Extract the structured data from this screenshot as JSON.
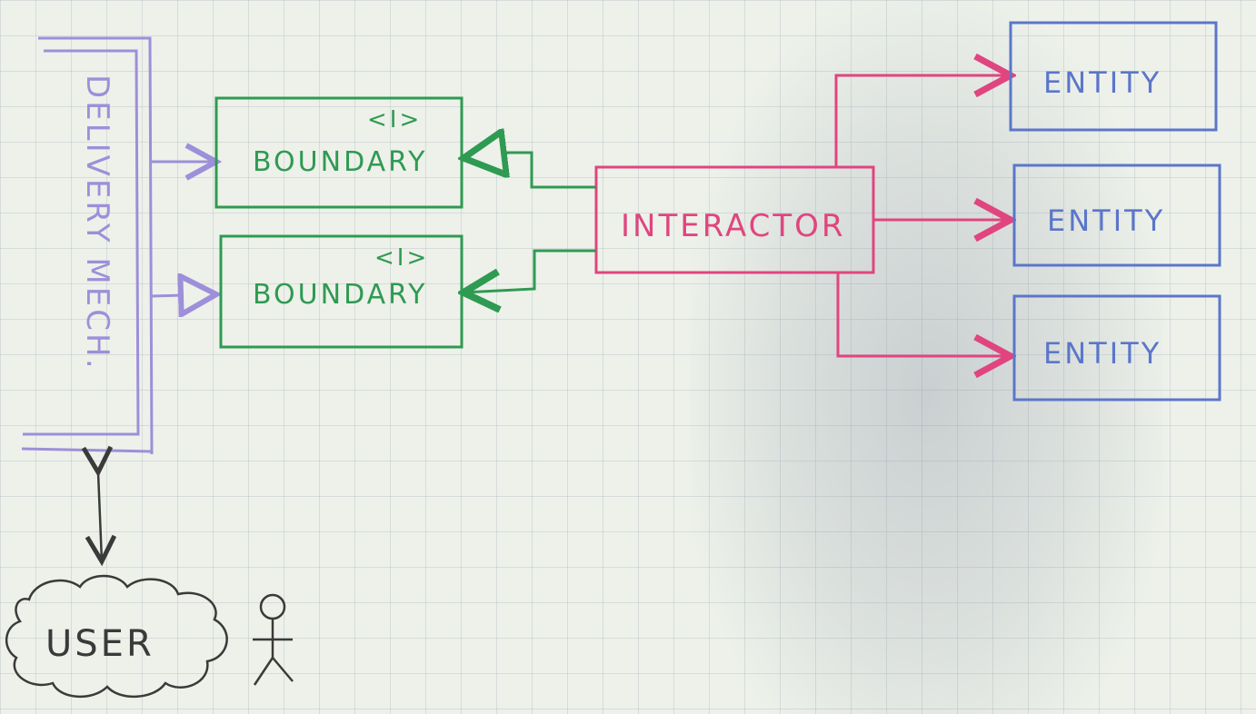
{
  "diagram": {
    "delivery": {
      "label": "DELIVERY MECH.",
      "color": "#9d8fd9"
    },
    "boundary_top": {
      "label": "BOUNDARY",
      "stereotype": "<I>",
      "color": "#2f9a52"
    },
    "boundary_bottom": {
      "label": "BOUNDARY",
      "stereotype": "<I>",
      "color": "#2f9a52"
    },
    "interactor": {
      "label": "INTERACTOR",
      "color": "#e0457f"
    },
    "entities": [
      {
        "label": "ENTITY"
      },
      {
        "label": "ENTITY"
      },
      {
        "label": "ENTITY"
      }
    ],
    "entity_color": "#5b76c9",
    "user": {
      "label": "USER",
      "color": "#3a3a3a"
    }
  }
}
